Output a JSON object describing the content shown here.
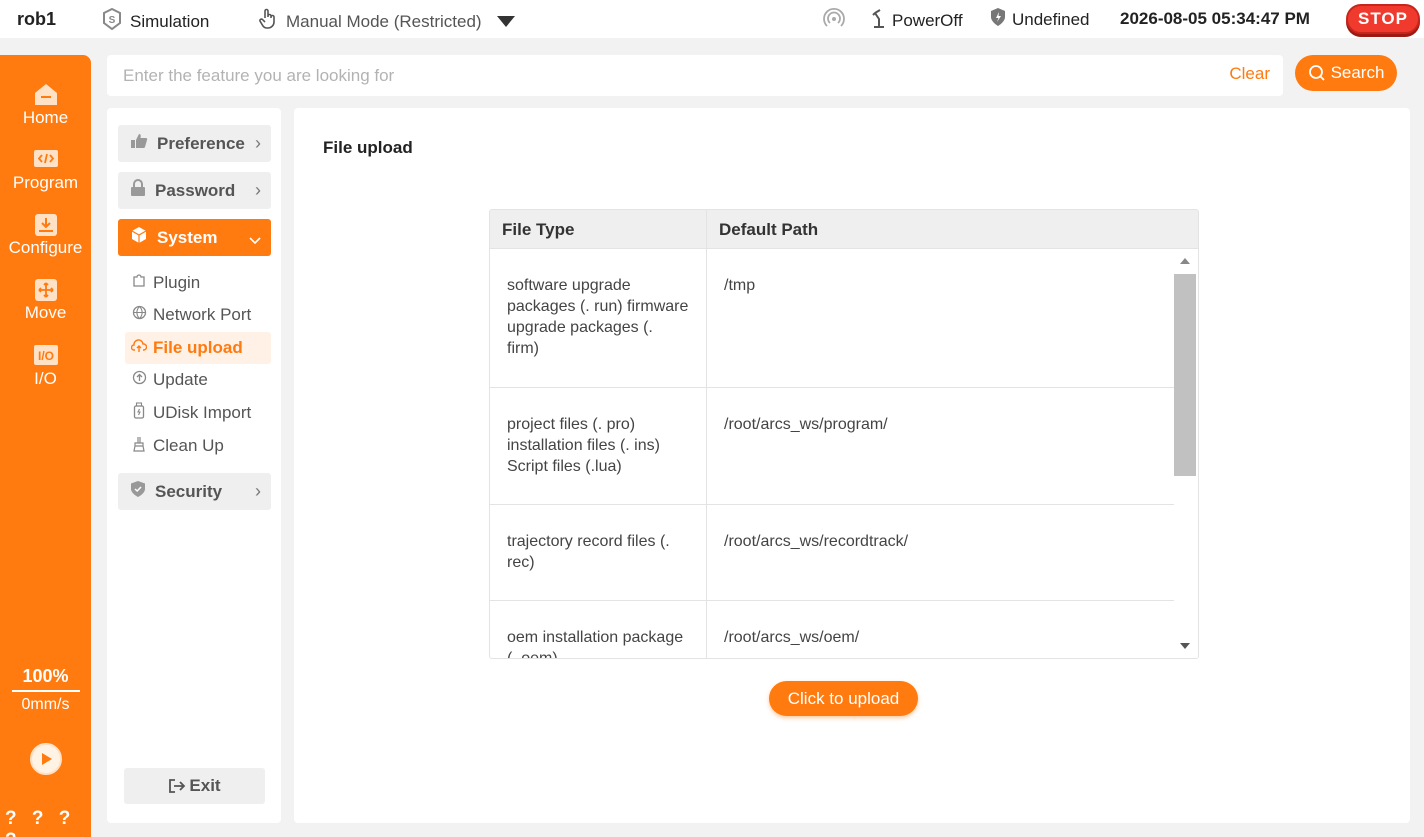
{
  "topbar": {
    "robot_name": "rob1",
    "simulation_label": "Simulation",
    "mode_label": "Manual Mode (Restricted)",
    "power_label": "PowerOff",
    "safety_label": "Undefined",
    "datetime": "2026-08-05 05:34:47 PM",
    "stop_label": "STOP"
  },
  "rail": {
    "items": [
      {
        "label": "Home",
        "icon": "home-icon"
      },
      {
        "label": "Program",
        "icon": "code-icon"
      },
      {
        "label": "Configure",
        "icon": "configure-icon"
      },
      {
        "label": "Move",
        "icon": "move-icon"
      },
      {
        "label": "I/O",
        "icon": "io-icon"
      }
    ],
    "speed_percent": "100%",
    "speed_value": "0mm/s",
    "status_marks": "? ? ? ?"
  },
  "search": {
    "placeholder": "Enter the feature you are looking for",
    "clear_label": "Clear",
    "button_label": "Search"
  },
  "subnav": {
    "groups": {
      "preference": "Preference",
      "password": "Password",
      "system": "System",
      "security": "Security"
    },
    "system_items": [
      {
        "label": "Plugin",
        "icon": "puzzle-icon"
      },
      {
        "label": "Network Port",
        "icon": "globe-icon"
      },
      {
        "label": "File upload",
        "icon": "cloud-upload-icon"
      },
      {
        "label": "Update",
        "icon": "arrow-up-circle-icon"
      },
      {
        "label": "UDisk Import",
        "icon": "usb-icon"
      },
      {
        "label": "Clean Up",
        "icon": "broom-icon"
      }
    ],
    "exit_label": "Exit"
  },
  "main": {
    "title": "File upload",
    "table": {
      "headers": [
        "File Type",
        "Default Path"
      ],
      "rows": [
        {
          "type": "software upgrade packages (. run) firmware upgrade packages (. firm)",
          "path": "/tmp"
        },
        {
          "type": "project files (. pro) installation files (. ins) Script files (.lua)",
          "path": "/root/arcs_ws/program/"
        },
        {
          "type": "trajectory record files (. rec)",
          "path": "/root/arcs_ws/recordtrack/"
        },
        {
          "type": "oem installation package (. oem)",
          "path": "/root/arcs_ws/oem/"
        }
      ]
    },
    "upload_label": "Click to upload"
  },
  "colors": {
    "accent": "#ff7a0f",
    "stop": "#f03a2e"
  }
}
